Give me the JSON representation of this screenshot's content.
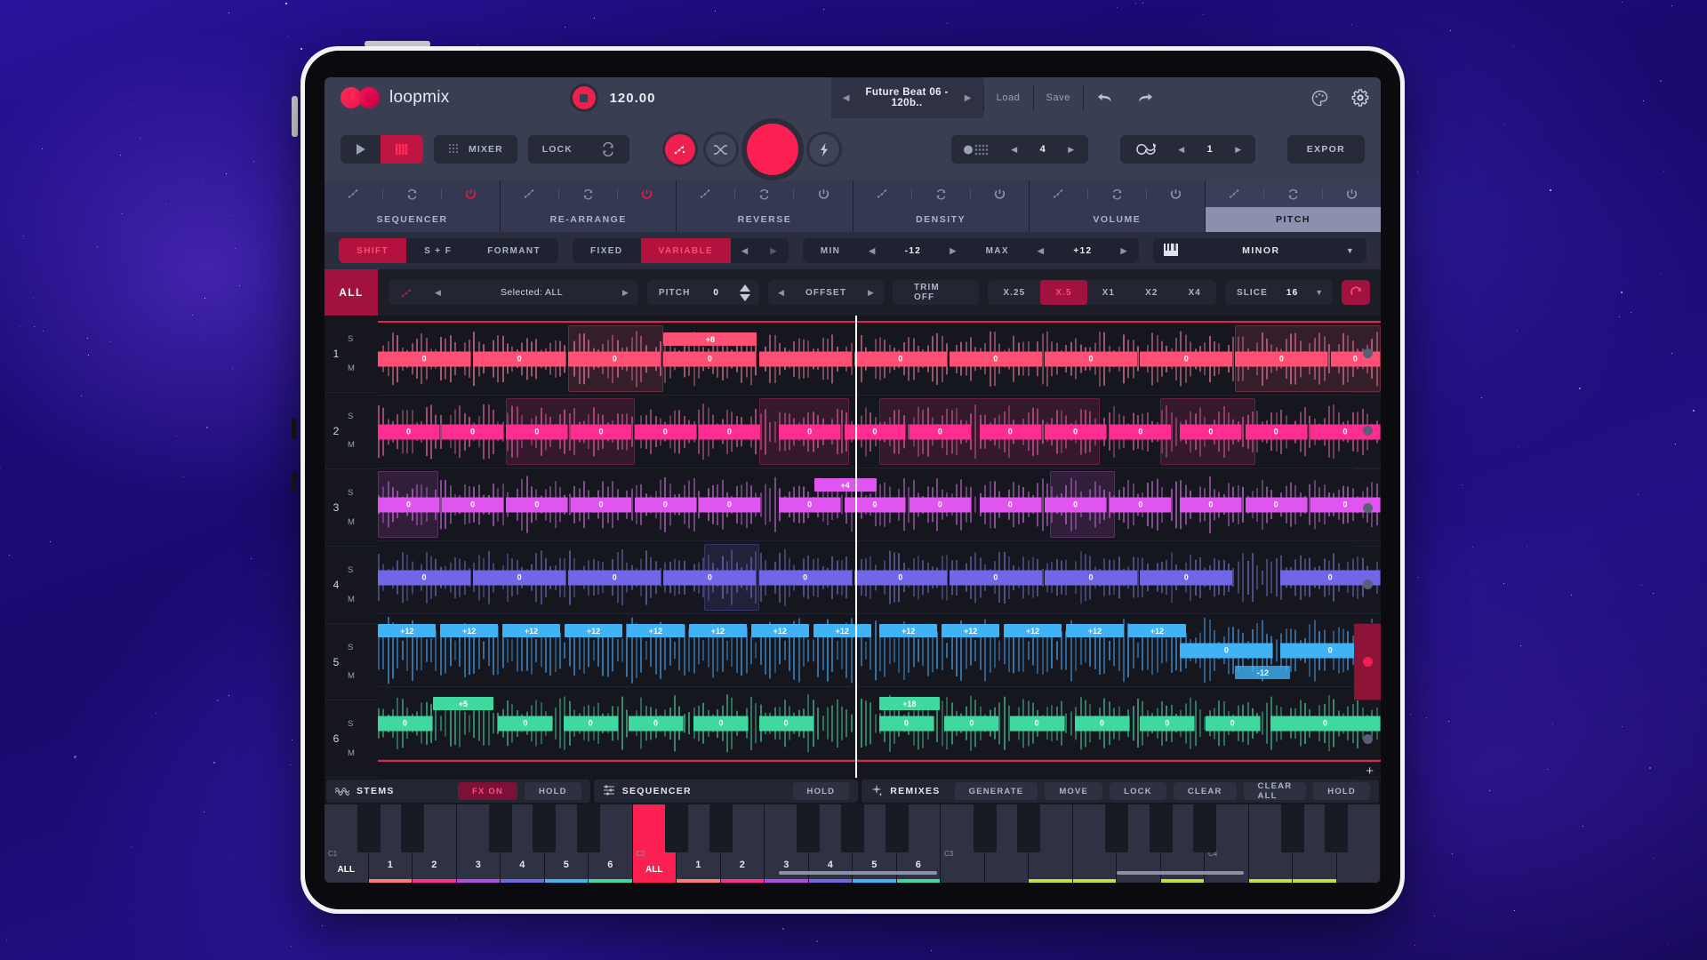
{
  "app": {
    "name": "loopmix",
    "bpm": "120.00",
    "preset": "Future Beat 06 - 120b..",
    "load_label": "Load",
    "save_label": "Save"
  },
  "topbar": {
    "icons": [
      "record-icon",
      "prev-preset-icon",
      "next-preset-icon",
      "undo-icon",
      "redo-icon",
      "palette-icon",
      "gear-icon"
    ]
  },
  "transport": {
    "play_label": "",
    "keys_label": "",
    "mixer_label": "MIXER",
    "lock_label": "LOCK",
    "sync_label": "",
    "bars_value": "4",
    "loop_value": "1",
    "export_label": "EXPOR"
  },
  "tabs": [
    {
      "label": "SEQUENCER",
      "active": false
    },
    {
      "label": "RE-ARRANGE",
      "active": false
    },
    {
      "label": "REVERSE",
      "active": false
    },
    {
      "label": "DENSITY",
      "active": false
    },
    {
      "label": "VOLUME",
      "active": false
    },
    {
      "label": "PITCH",
      "active": true
    }
  ],
  "pitch_params": {
    "mode_options": [
      "SHIFT",
      "S + F",
      "FORMANT"
    ],
    "mode_selected": "SHIFT",
    "range_options": [
      "FIXED",
      "VARIABLE"
    ],
    "range_selected": "VARIABLE",
    "min_label": "MIN",
    "min_value": "-12",
    "max_label": "MAX",
    "max_value": "+12",
    "scale_name": "MINOR"
  },
  "editor_toolbar": {
    "all_label": "ALL",
    "selected_label": "Selected: ALL",
    "pitch_label": "PITCH",
    "pitch_value": "0",
    "offset_label": "OFFSET",
    "trim_label": "TRIM OFF",
    "zoom_options": [
      "X.25",
      "X.5",
      "X1",
      "X2",
      "X4"
    ],
    "zoom_selected": "X.5",
    "slice_label": "SLICE",
    "slice_value": "16",
    "refresh_icon": "refresh-icon"
  },
  "tracks": [
    {
      "number": "1",
      "solo_label": "S",
      "mute_label": "M",
      "color": "#ff4f74",
      "wave_color": "#b4647e",
      "segments": [
        {
          "x": 0.0,
          "w": 0.093,
          "label": "0"
        },
        {
          "x": 0.095,
          "w": 0.093,
          "label": "0"
        },
        {
          "x": 0.19,
          "w": 0.093,
          "label": "0"
        },
        {
          "x": 0.285,
          "w": 0.093,
          "label": "0"
        },
        {
          "x": 0.38,
          "w": 0.093,
          "label": ""
        },
        {
          "x": 0.475,
          "w": 0.093,
          "label": "0"
        },
        {
          "x": 0.57,
          "w": 0.093,
          "label": "0"
        },
        {
          "x": 0.665,
          "w": 0.093,
          "label": "0"
        },
        {
          "x": 0.76,
          "w": 0.093,
          "label": "0"
        },
        {
          "x": 0.855,
          "w": 0.093,
          "label": "0"
        },
        {
          "x": 0.95,
          "w": 0.05,
          "label": "0"
        }
      ],
      "above": [
        {
          "x": 0.285,
          "w": 0.093,
          "label": "+8"
        }
      ],
      "clips": [
        {
          "x": 0.19,
          "w": 0.095
        },
        {
          "x": 0.855,
          "w": 0.145
        }
      ]
    },
    {
      "number": "2",
      "solo_label": "S",
      "mute_label": "M",
      "color": "#ff2d92",
      "wave_color": "#a8557e",
      "segments": [
        {
          "x": 0.0,
          "w": 0.062,
          "label": "0"
        },
        {
          "x": 0.064,
          "w": 0.062,
          "label": "0"
        },
        {
          "x": 0.128,
          "w": 0.062,
          "label": "0"
        },
        {
          "x": 0.192,
          "w": 0.062,
          "label": "0"
        },
        {
          "x": 0.256,
          "w": 0.062,
          "label": "0"
        },
        {
          "x": 0.32,
          "w": 0.062,
          "label": "0"
        },
        {
          "x": 0.4,
          "w": 0.062,
          "label": "0"
        },
        {
          "x": 0.465,
          "w": 0.062,
          "label": "0"
        },
        {
          "x": 0.53,
          "w": 0.062,
          "label": "0"
        },
        {
          "x": 0.6,
          "w": 0.062,
          "label": "0"
        },
        {
          "x": 0.665,
          "w": 0.062,
          "label": "0"
        },
        {
          "x": 0.73,
          "w": 0.062,
          "label": "0"
        },
        {
          "x": 0.8,
          "w": 0.062,
          "label": "0"
        },
        {
          "x": 0.865,
          "w": 0.062,
          "label": "0"
        },
        {
          "x": 0.93,
          "w": 0.07,
          "label": "0"
        }
      ],
      "above": [],
      "clips": [
        {
          "x": 0.128,
          "w": 0.128
        },
        {
          "x": 0.38,
          "w": 0.09
        },
        {
          "x": 0.5,
          "w": 0.22
        },
        {
          "x": 0.78,
          "w": 0.095
        }
      ]
    },
    {
      "number": "3",
      "solo_label": "S",
      "mute_label": "M",
      "color": "#e054f0",
      "wave_color": "#9a5aa8",
      "segments": [
        {
          "x": 0.0,
          "w": 0.062,
          "label": "0"
        },
        {
          "x": 0.064,
          "w": 0.062,
          "label": "0"
        },
        {
          "x": 0.128,
          "w": 0.062,
          "label": "0"
        },
        {
          "x": 0.192,
          "w": 0.062,
          "label": "0"
        },
        {
          "x": 0.256,
          "w": 0.062,
          "label": "0"
        },
        {
          "x": 0.32,
          "w": 0.062,
          "label": "0"
        },
        {
          "x": 0.4,
          "w": 0.062,
          "label": "0"
        },
        {
          "x": 0.465,
          "w": 0.062,
          "label": "0"
        },
        {
          "x": 0.53,
          "w": 0.062,
          "label": "0"
        },
        {
          "x": 0.6,
          "w": 0.062,
          "label": "0"
        },
        {
          "x": 0.665,
          "w": 0.062,
          "label": "0"
        },
        {
          "x": 0.73,
          "w": 0.062,
          "label": "0"
        },
        {
          "x": 0.8,
          "w": 0.062,
          "label": "0"
        },
        {
          "x": 0.865,
          "w": 0.062,
          "label": "0"
        },
        {
          "x": 0.93,
          "w": 0.07,
          "label": "0"
        }
      ],
      "above": [
        {
          "x": 0.435,
          "w": 0.062,
          "label": "+4"
        }
      ],
      "clips": [
        {
          "x": 0.0,
          "w": 0.06
        },
        {
          "x": 0.67,
          "w": 0.065
        }
      ]
    },
    {
      "number": "4",
      "solo_label": "S",
      "mute_label": "M",
      "color": "#6f67e8",
      "wave_color": "#5a5a96",
      "segments": [
        {
          "x": 0.0,
          "w": 0.093,
          "label": "0"
        },
        {
          "x": 0.095,
          "w": 0.093,
          "label": "0"
        },
        {
          "x": 0.19,
          "w": 0.093,
          "label": "0"
        },
        {
          "x": 0.285,
          "w": 0.093,
          "label": "0"
        },
        {
          "x": 0.38,
          "w": 0.093,
          "label": "0"
        },
        {
          "x": 0.475,
          "w": 0.093,
          "label": "0"
        },
        {
          "x": 0.57,
          "w": 0.093,
          "label": "0"
        },
        {
          "x": 0.665,
          "w": 0.093,
          "label": "0"
        },
        {
          "x": 0.76,
          "w": 0.093,
          "label": "0"
        },
        {
          "x": 0.9,
          "w": 0.1,
          "label": "0"
        }
      ],
      "above": [],
      "clips": [
        {
          "x": 0.325,
          "w": 0.055
        }
      ]
    },
    {
      "number": "5",
      "solo_label": "S",
      "mute_label": "M",
      "color": "#3fb3f5",
      "wave_color": "#3b7fb8",
      "segments": [
        {
          "x": 0.8,
          "w": 0.093,
          "label": "0"
        },
        {
          "x": 0.9,
          "w": 0.1,
          "label": "0"
        }
      ],
      "above": [
        {
          "x": 0.0,
          "w": 0.058,
          "label": "+12"
        },
        {
          "x": 0.062,
          "w": 0.058,
          "label": "+12"
        },
        {
          "x": 0.124,
          "w": 0.058,
          "label": "+12"
        },
        {
          "x": 0.186,
          "w": 0.058,
          "label": "+12"
        },
        {
          "x": 0.248,
          "w": 0.058,
          "label": "+12"
        },
        {
          "x": 0.31,
          "w": 0.058,
          "label": "+12"
        },
        {
          "x": 0.372,
          "w": 0.058,
          "label": "+12"
        },
        {
          "x": 0.434,
          "w": 0.058,
          "label": "+12"
        },
        {
          "x": 0.5,
          "w": 0.058,
          "label": "+12"
        },
        {
          "x": 0.562,
          "w": 0.058,
          "label": "+12"
        },
        {
          "x": 0.624,
          "w": 0.058,
          "label": "+12"
        },
        {
          "x": 0.686,
          "w": 0.058,
          "label": "+12"
        },
        {
          "x": 0.748,
          "w": 0.058,
          "label": "+12"
        }
      ],
      "below": [
        {
          "x": 0.855,
          "w": 0.055,
          "label": "-12"
        }
      ],
      "clips": [],
      "record": true
    },
    {
      "number": "6",
      "solo_label": "S",
      "mute_label": "M",
      "color": "#3fd9a0",
      "wave_color": "#3e9a79",
      "segments": [
        {
          "x": 0.0,
          "w": 0.055,
          "label": "0"
        },
        {
          "x": 0.12,
          "w": 0.055,
          "label": "0"
        },
        {
          "x": 0.185,
          "w": 0.055,
          "label": "0"
        },
        {
          "x": 0.25,
          "w": 0.055,
          "label": "0"
        },
        {
          "x": 0.315,
          "w": 0.055,
          "label": "0"
        },
        {
          "x": 0.38,
          "w": 0.055,
          "label": "0"
        },
        {
          "x": 0.5,
          "w": 0.055,
          "label": "0"
        },
        {
          "x": 0.565,
          "w": 0.055,
          "label": "0"
        },
        {
          "x": 0.63,
          "w": 0.055,
          "label": "0"
        },
        {
          "x": 0.695,
          "w": 0.055,
          "label": "0"
        },
        {
          "x": 0.76,
          "w": 0.055,
          "label": "0"
        },
        {
          "x": 0.825,
          "w": 0.055,
          "label": "0"
        },
        {
          "x": 0.89,
          "w": 0.11,
          "label": "0"
        }
      ],
      "above": [
        {
          "x": 0.055,
          "w": 0.06,
          "label": "+5"
        },
        {
          "x": 0.5,
          "w": 0.06,
          "label": "+18"
        }
      ],
      "clips": []
    }
  ],
  "bottom_panels": {
    "stems": {
      "title": "STEMS",
      "icon": "waveform-icon",
      "fx_label": "FX ON",
      "hold_label": "HOLD"
    },
    "sequencer": {
      "title": "SEQUENCER",
      "icon": "sequencer-icon",
      "hold_label": "HOLD"
    },
    "remixes": {
      "title": "REMIXES",
      "icon": "sparkle-icon",
      "buttons": [
        "GENERATE",
        "MOVE",
        "LOCK",
        "CLEAR",
        "CLEAR ALL",
        "HOLD"
      ]
    }
  },
  "keyboard": {
    "octave_labels": [
      "C1",
      "C2",
      "C3",
      "C4"
    ],
    "all_label": "ALL",
    "keys": [
      {
        "label": "ALL",
        "octave": "C1",
        "selected": false,
        "bar": ""
      },
      {
        "label": "1",
        "selected": false,
        "bar": "#ff7a7a"
      },
      {
        "label": "2",
        "selected": false,
        "bar": "#ff2d92"
      },
      {
        "label": "3",
        "selected": false,
        "bar": "#b44ae8"
      },
      {
        "label": "4",
        "selected": false,
        "bar": "#6f67e8"
      },
      {
        "label": "5",
        "selected": false,
        "bar": "#3fb3f5"
      },
      {
        "label": "6",
        "selected": false,
        "bar": "#3fd9a0"
      },
      {
        "label": "ALL",
        "octave": "C2",
        "selected": true,
        "bar": ""
      },
      {
        "label": "1",
        "selected": false,
        "bar": "#ff7a7a"
      },
      {
        "label": "2",
        "selected": false,
        "bar": "#ff2d92"
      },
      {
        "label": "3",
        "selected": false,
        "bar": "#b44ae8"
      },
      {
        "label": "4",
        "selected": false,
        "bar": "#6f67e8"
      },
      {
        "label": "5",
        "selected": false,
        "bar": "#3fb3f5"
      },
      {
        "label": "6",
        "selected": false,
        "bar": "#3fd9a0"
      },
      {
        "label": "",
        "octave": "C3",
        "selected": false,
        "bar": ""
      },
      {
        "label": "",
        "selected": false,
        "bar": ""
      },
      {
        "label": "",
        "selected": false,
        "bar": "#c3e03a"
      },
      {
        "label": "",
        "selected": false,
        "bar": "#c3e03a"
      },
      {
        "label": "",
        "selected": false,
        "bar": ""
      },
      {
        "label": "",
        "selected": false,
        "bar": "#c3e03a"
      },
      {
        "label": "",
        "octave": "C4",
        "selected": false,
        "bar": ""
      },
      {
        "label": "",
        "selected": false,
        "bar": "#c3e03a"
      },
      {
        "label": "",
        "selected": false,
        "bar": "#c3e03a"
      },
      {
        "label": "",
        "selected": false,
        "bar": ""
      }
    ]
  },
  "colors": {
    "accent_red": "#fb1f52",
    "accent_dark_red": "#a2123f",
    "panel": "#3a3e52",
    "panel_dark": "#2a2d3e",
    "editor_bg": "#15161e"
  }
}
